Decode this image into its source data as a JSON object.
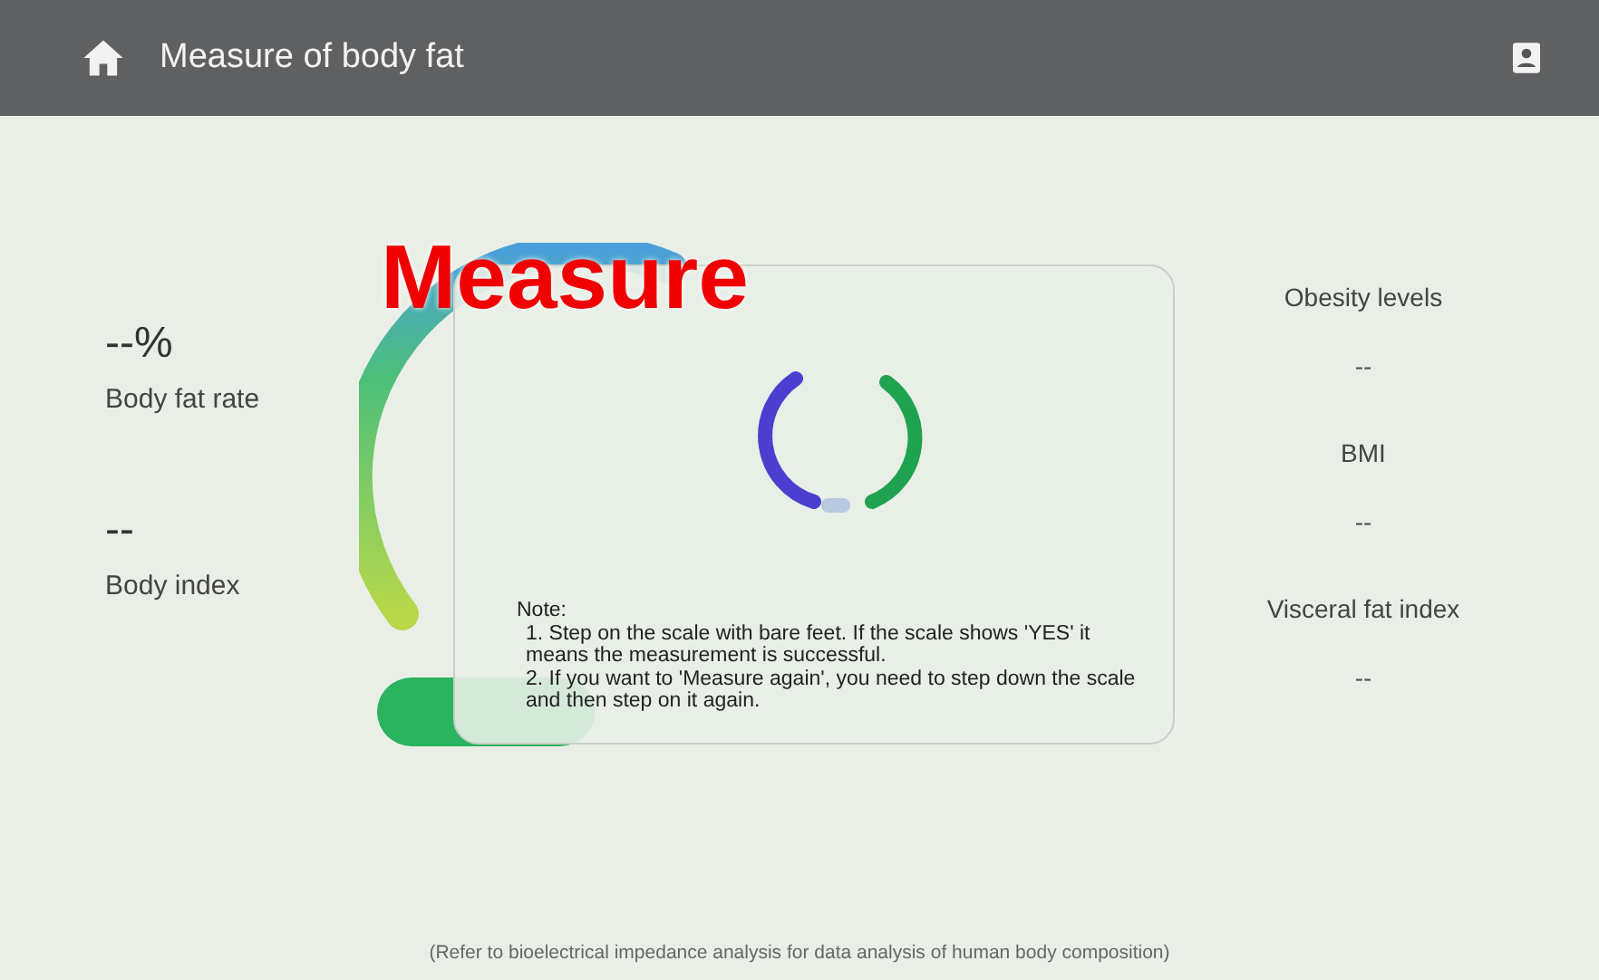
{
  "header": {
    "title": "Measure of body fat"
  },
  "left_metrics": [
    {
      "value": "--%",
      "label": "Body fat rate"
    },
    {
      "value": "--",
      "label": "Body index"
    }
  ],
  "right_metrics": [
    {
      "label": "Obesity levels",
      "value": "--"
    },
    {
      "label": "BMI",
      "value": "--"
    },
    {
      "label": "Visceral fat index",
      "value": "--"
    }
  ],
  "dialog": {
    "note_title": "Note:",
    "notes": [
      "1. Step on the scale with bare feet. If the scale shows 'YES' it means the measurement is successful.",
      "2. If you want to 'Measure again', you need to step down the scale and then step on it again."
    ]
  },
  "overlay_label": "Measure",
  "footer": "(Refer to bioelectrical impedance analysis for data analysis of human body composition)"
}
